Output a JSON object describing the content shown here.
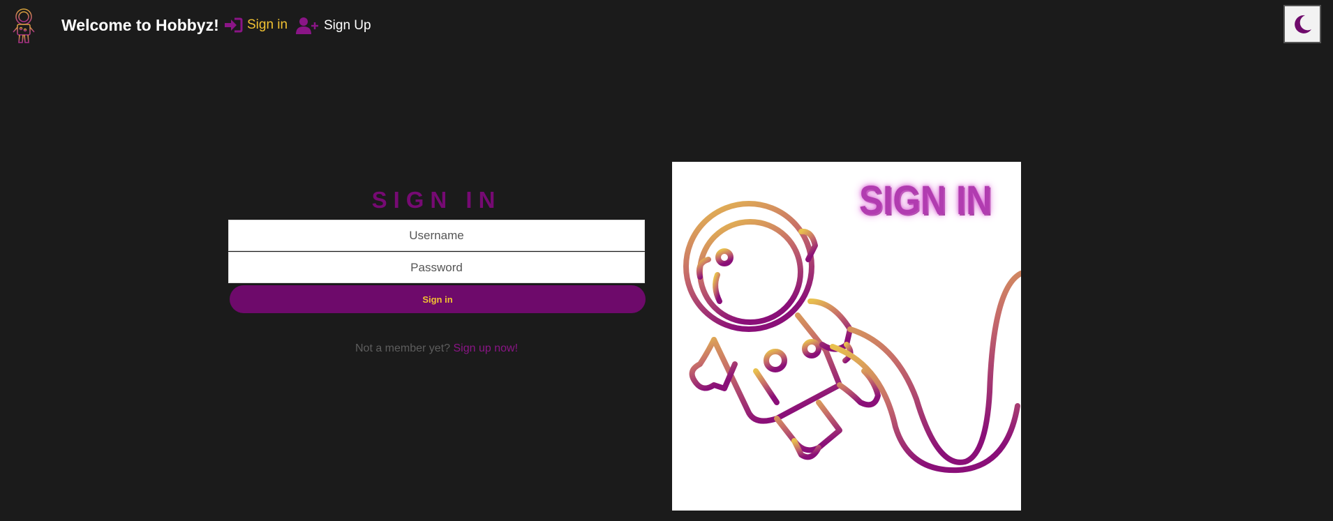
{
  "header": {
    "brand": "Welcome to Hobbyz!",
    "nav": [
      {
        "label": "Sign in",
        "icon": "sign-in-icon",
        "color": "#f1c232"
      },
      {
        "label": "Sign Up",
        "icon": "user-plus-icon",
        "color": "#ffffff"
      }
    ],
    "theme_toggle_icon": "moon-icon"
  },
  "form": {
    "title": "SIGN IN",
    "username_placeholder": "Username",
    "password_placeholder": "Password",
    "submit_label": "Sign in",
    "member_text": "Not a member yet?",
    "signup_link": "Sign up now!"
  },
  "hero": {
    "title": "SIGN IN",
    "image": "astronaut-illustration"
  },
  "colors": {
    "background": "#1b1b1b",
    "accent_purple": "#6e0a6b",
    "accent_gold": "#f1c232"
  }
}
